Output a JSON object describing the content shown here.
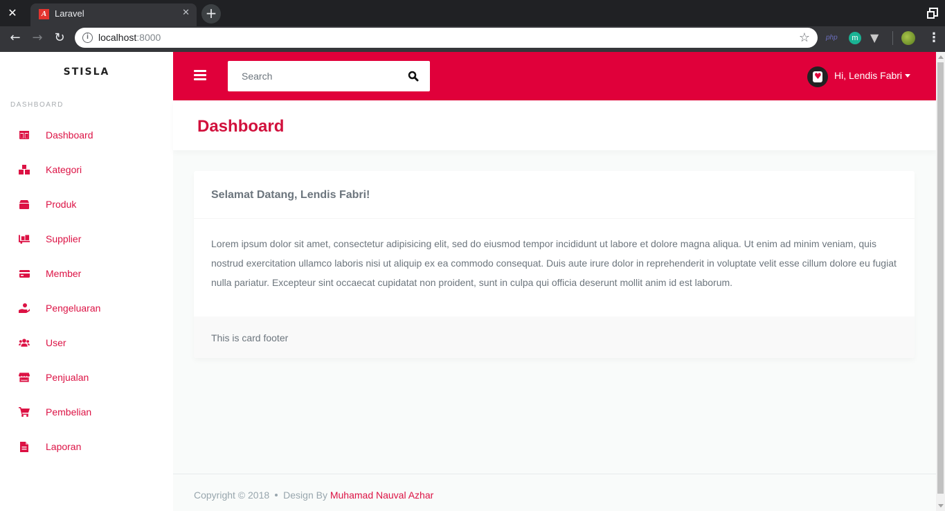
{
  "browser": {
    "tab_title": "Laravel",
    "url_host": "localhost",
    "url_port": ":8000",
    "ext_php_label": "php",
    "ext_m_label": "m"
  },
  "sidebar": {
    "brand": "STISLA",
    "menu_header": "DASHBOARD",
    "items": [
      {
        "label": "Dashboard",
        "icon": "columns-icon"
      },
      {
        "label": "Kategori",
        "icon": "cubes-icon"
      },
      {
        "label": "Produk",
        "icon": "box-icon"
      },
      {
        "label": "Supplier",
        "icon": "truck-loading-icon"
      },
      {
        "label": "Member",
        "icon": "credit-card-icon"
      },
      {
        "label": "Pengeluaran",
        "icon": "hand-holding-usd-icon"
      },
      {
        "label": "User",
        "icon": "users-icon"
      },
      {
        "label": "Penjualan",
        "icon": "store-icon"
      },
      {
        "label": "Pembelian",
        "icon": "cart-icon"
      },
      {
        "label": "Laporan",
        "icon": "file-icon"
      }
    ]
  },
  "navbar": {
    "search_placeholder": "Search",
    "user_greeting": "Hi, Lendis Fabri"
  },
  "section": {
    "title": "Dashboard"
  },
  "card": {
    "title": "Selamat Datang, Lendis Fabri!",
    "body": "Lorem ipsum dolor sit amet, consectetur adipisicing elit, sed do eiusmod tempor incididunt ut labore et dolore magna aliqua. Ut enim ad minim veniam, quis nostrud exercitation ullamco laboris nisi ut aliquip ex ea commodo consequat. Duis aute irure dolor in reprehenderit in voluptate velit esse cillum dolore eu fugiat nulla pariatur. Excepteur sint occaecat cupidatat non proident, sunt in culpa qui officia deserunt mollit anim id est laborum.",
    "footer": "This is card footer"
  },
  "footer": {
    "copyright": "Copyright © 2018",
    "design_by": "Design By",
    "author": "Muhamad Nauval Azhar"
  },
  "colors": {
    "primary": "#e0003a",
    "menu_text": "#dc1244"
  }
}
